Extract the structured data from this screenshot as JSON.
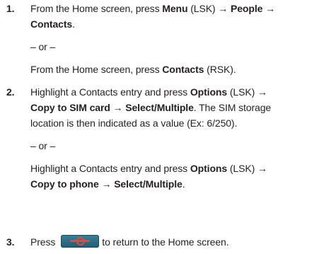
{
  "steps": [
    {
      "number": "1.",
      "lines": [
        {
          "parts": [
            "From the Home screen, press ",
            "Menu",
            " (LSK) ",
            "→",
            " ",
            "People",
            " ",
            "→"
          ]
        },
        {
          "parts": [
            "Contacts",
            "."
          ]
        },
        {
          "text": "– or –"
        },
        {
          "parts": [
            "From the Home screen, press ",
            "Contacts",
            " (RSK)."
          ]
        }
      ]
    },
    {
      "number": "2.",
      "lines": [
        {
          "parts": [
            "Highlight a Contacts entry and press ",
            "Options",
            " (LSK) ",
            "→"
          ]
        },
        {
          "parts": [
            "Copy to SIM card ",
            "→",
            " ",
            "Select/Multiple",
            ". The SIM storage"
          ]
        },
        {
          "text": "location is then indicated as a value (Ex: 6/250)."
        },
        {
          "text": "– or –"
        },
        {
          "parts": [
            "Highlight a Contacts entry and press ",
            "Options",
            " (LSK) ",
            "→"
          ]
        },
        {
          "parts": [
            "Copy to phone ",
            "→",
            " ",
            "Select/Multiple",
            "."
          ]
        }
      ]
    },
    {
      "number": "3.",
      "lines": [
        {
          "parts": [
            "Press",
            "to return to the Home screen."
          ]
        }
      ],
      "key_icon": "end-key-icon"
    }
  ]
}
